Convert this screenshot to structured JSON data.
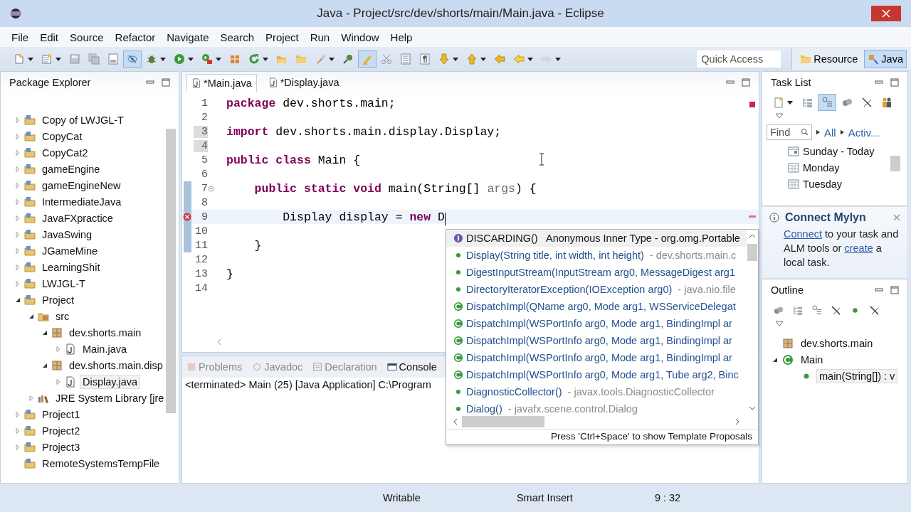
{
  "window": {
    "title": "Java - Project/src/dev/shorts/main/Main.java - Eclipse"
  },
  "menu": [
    "File",
    "Edit",
    "Source",
    "Refactor",
    "Navigate",
    "Search",
    "Project",
    "Run",
    "Window",
    "Help"
  ],
  "toolbar": {
    "buttons": [
      {
        "kind": "new-file",
        "dropdown": true,
        "pressed": false
      },
      {
        "kind": "new-package",
        "dropdown": true,
        "pressed": false
      },
      {
        "kind": "save",
        "dropdown": false,
        "pressed": false
      },
      {
        "kind": "save-all",
        "dropdown": false,
        "pressed": false
      },
      {
        "kind": "binary-page",
        "dropdown": false,
        "pressed": false
      },
      {
        "kind": "eye-crossed",
        "dropdown": false,
        "pressed": true
      },
      {
        "kind": "bug",
        "dropdown": true,
        "pressed": false
      },
      {
        "kind": "play",
        "dropdown": true,
        "pressed": false
      },
      {
        "kind": "play-box",
        "dropdown": true,
        "pressed": false
      },
      {
        "kind": "package-box",
        "dropdown": false,
        "pressed": false
      },
      {
        "kind": "refresh",
        "dropdown": true,
        "pressed": false
      },
      {
        "kind": "folder-open",
        "dropdown": false,
        "pressed": false
      },
      {
        "kind": "folder",
        "dropdown": false,
        "pressed": false
      },
      {
        "kind": "brush",
        "dropdown": true,
        "pressed": false
      },
      {
        "kind": "pin",
        "dropdown": false,
        "pressed": false
      },
      {
        "kind": "highlighter",
        "dropdown": false,
        "pressed": true
      },
      {
        "kind": "scissors",
        "dropdown": false,
        "pressed": false
      },
      {
        "kind": "list-page",
        "dropdown": false,
        "pressed": false
      },
      {
        "kind": "pilcrow-page",
        "dropdown": false,
        "pressed": false
      },
      {
        "kind": "arrow-down",
        "dropdown": true,
        "pressed": false
      },
      {
        "kind": "arrow-up",
        "dropdown": true,
        "pressed": false
      },
      {
        "kind": "arrow-left-edit",
        "dropdown": false,
        "pressed": false
      },
      {
        "kind": "arrow-left",
        "dropdown": true,
        "pressed": false
      },
      {
        "kind": "arrow-right",
        "dropdown": true,
        "pressed": false
      }
    ],
    "quick_access": {
      "placeholder": "Quick Access"
    },
    "perspectives": [
      {
        "label": "Resource",
        "kind": "folder",
        "selected": false
      },
      {
        "label": "Java",
        "kind": "java",
        "selected": true
      }
    ]
  },
  "package_explorer": {
    "title": "Package Explorer",
    "items": [
      {
        "label": "Copy of LWJGL-T",
        "kind": "project",
        "expanded": false,
        "selected": false
      },
      {
        "label": "CopyCat",
        "kind": "project",
        "expanded": false,
        "selected": false
      },
      {
        "label": "CopyCat2",
        "kind": "project",
        "expanded": false,
        "selected": false
      },
      {
        "label": "gameEngine",
        "kind": "project",
        "expanded": false,
        "selected": false
      },
      {
        "label": "gameEngineNew",
        "kind": "project",
        "expanded": false,
        "selected": false
      },
      {
        "label": "IntermediateJava",
        "kind": "project",
        "expanded": false,
        "selected": false
      },
      {
        "label": "JavaFXpractice",
        "kind": "project",
        "expanded": false,
        "selected": false
      },
      {
        "label": "JavaSwing",
        "kind": "project",
        "expanded": false,
        "selected": false
      },
      {
        "label": "JGameMine",
        "kind": "project",
        "expanded": false,
        "selected": false
      },
      {
        "label": "LearningShit",
        "kind": "project",
        "expanded": false,
        "selected": false
      },
      {
        "label": "LWJGL-T",
        "kind": "project",
        "expanded": false,
        "selected": false
      },
      {
        "label": "Project",
        "kind": "project",
        "expanded": true,
        "selected": false,
        "children": [
          {
            "label": "src",
            "kind": "source-folder",
            "expanded": true,
            "selected": false,
            "children": [
              {
                "label": "dev.shorts.main",
                "kind": "package",
                "expanded": true,
                "selected": false,
                "children": [
                  {
                    "label": "Main.java",
                    "kind": "java-file",
                    "expanded": false,
                    "selected": false
                  }
                ]
              },
              {
                "label": "dev.shorts.main.disp",
                "kind": "package",
                "expanded": true,
                "selected": false,
                "children": [
                  {
                    "label": "Display.java",
                    "kind": "java-file",
                    "expanded": false,
                    "selected": true
                  }
                ]
              }
            ]
          },
          {
            "label": "JRE System Library [jre",
            "kind": "library",
            "expanded": false,
            "selected": false
          }
        ]
      },
      {
        "label": "Project1",
        "kind": "project",
        "expanded": false,
        "selected": false
      },
      {
        "label": "Project2",
        "kind": "project",
        "expanded": false,
        "selected": false
      },
      {
        "label": "Project3",
        "kind": "project",
        "expanded": false,
        "selected": false
      },
      {
        "label": "RemoteSystemsTempFile",
        "kind": "project",
        "selected": false
      }
    ]
  },
  "editor": {
    "tabs": [
      {
        "label": "*Main.java",
        "selected": true
      },
      {
        "label": "*Display.java",
        "selected": false
      }
    ],
    "lines": [
      {
        "number": "1",
        "tokens": [
          {
            "kind": "keyword",
            "text": "package"
          },
          {
            "kind": "plain",
            "text": " dev.shorts.main;"
          }
        ],
        "shaded": false,
        "changed": false,
        "error": false
      },
      {
        "number": "2",
        "shaded": false,
        "changed": false,
        "error": false
      },
      {
        "number": "3",
        "tokens": [
          {
            "kind": "keyword",
            "text": "import"
          },
          {
            "kind": "plain",
            "text": " dev.shorts.main.display.Display;"
          }
        ],
        "shaded": true,
        "changed": false,
        "error": false
      },
      {
        "number": "4",
        "shaded": true,
        "changed": false,
        "error": false
      },
      {
        "number": "5",
        "tokens": [
          {
            "kind": "keyword",
            "text": "public class"
          },
          {
            "kind": "plain",
            "text": " Main {"
          }
        ],
        "shaded": false,
        "changed": false,
        "error": false
      },
      {
        "number": "6",
        "shaded": false,
        "changed": false,
        "error": false
      },
      {
        "number": "7",
        "tokens": [
          {
            "kind": "keyword",
            "text": "    public static void"
          },
          {
            "kind": "plain",
            "text": " main(String[] "
          },
          {
            "kind": "param",
            "text": "args"
          },
          {
            "kind": "plain",
            "text": ") {"
          }
        ],
        "shaded": false,
        "changed": true,
        "error": false,
        "foldable": true
      },
      {
        "number": "8",
        "shaded": false,
        "changed": true,
        "error": false
      },
      {
        "number": "9",
        "tokens": [
          {
            "kind": "plain",
            "text": "        Display display = "
          },
          {
            "kind": "keyword",
            "text": "new"
          },
          {
            "kind": "plain",
            "text": " D"
          }
        ],
        "shaded": false,
        "changed": true,
        "error": true,
        "current": true
      },
      {
        "number": "10",
        "shaded": false,
        "changed": true,
        "error": false
      },
      {
        "number": "11",
        "tokens": [
          {
            "kind": "plain",
            "text": "    }"
          }
        ],
        "shaded": false,
        "changed": true,
        "error": false
      },
      {
        "number": "12",
        "shaded": false,
        "changed": false,
        "error": false
      },
      {
        "number": "13",
        "tokens": [
          {
            "kind": "plain",
            "text": "}"
          }
        ],
        "shaded": false,
        "changed": false,
        "error": false
      },
      {
        "number": "14",
        "shaded": false,
        "changed": false,
        "error": false
      }
    ]
  },
  "proposals": {
    "items": [
      {
        "kind": "interface",
        "name": "DISCARDING()",
        "detail": "  Anonymous Inner Type - org.omg.Portable",
        "selected": true
      },
      {
        "kind": "constructor",
        "name": "Display(String title, int width, int height)",
        "detail": " - dev.shorts.main.c",
        "selected": false
      },
      {
        "kind": "constructor",
        "name": "DigestInputStream(InputStream arg0, MessageDigest arg1",
        "selected": false
      },
      {
        "kind": "constructor",
        "name": "DirectoryIteratorException(IOException arg0)",
        "detail": " - java.nio.file",
        "selected": false
      },
      {
        "kind": "class",
        "name": "DispatchImpl(QName arg0, Mode arg1, WSServiceDelegat",
        "selected": false
      },
      {
        "kind": "class",
        "name": "DispatchImpl(WSPortInfo arg0, Mode arg1, BindingImpl ar",
        "selected": false
      },
      {
        "kind": "class",
        "name": "DispatchImpl(WSPortInfo arg0, Mode arg1, BindingImpl ar",
        "selected": false
      },
      {
        "kind": "class",
        "name": "DispatchImpl(WSPortInfo arg0, Mode arg1, BindingImpl ar",
        "selected": false
      },
      {
        "kind": "class",
        "name": "DispatchImpl(WSPortInfo arg0, Mode arg1, Tube arg2, Binc",
        "selected": false
      },
      {
        "kind": "constructor",
        "name": "DiagnosticCollector()",
        "detail": " - javax.tools.DiagnosticCollector",
        "selected": false
      },
      {
        "kind": "constructor",
        "name": "Dialog()",
        "detail": " - javafx.scene.control.Dialog",
        "selected": false
      }
    ],
    "hint": "Press 'Ctrl+Space' to show Template Proposals"
  },
  "views": {
    "tabs": [
      {
        "label": "Problems",
        "kind": "problems",
        "selected": false
      },
      {
        "label": "Javadoc",
        "kind": "javadoc",
        "selected": false
      },
      {
        "label": "Declaration",
        "kind": "declaration",
        "selected": false
      },
      {
        "label": "Console",
        "kind": "console",
        "selected": true
      }
    ],
    "console": "<terminated> Main (25) [Java Application] C:\\Program"
  },
  "task_list": {
    "title": "Task List",
    "tools": [
      {
        "kind": "new-task",
        "dropdown": true,
        "pressed": false
      },
      {
        "kind": "tree-list",
        "dropdown": false,
        "pressed": false
      },
      {
        "kind": "categorized",
        "dropdown": false,
        "pressed": true
      },
      {
        "kind": "spheres",
        "dropdown": false,
        "pressed": false
      },
      {
        "kind": "slash",
        "dropdown": false,
        "pressed": false
      },
      {
        "kind": "people",
        "dropdown": false,
        "pressed": false
      }
    ],
    "find": {
      "placeholder": "Find"
    },
    "filters": [
      "All",
      "Activ..."
    ],
    "items": [
      {
        "label": "Sunday - Today",
        "kind": "today"
      },
      {
        "label": "Monday",
        "kind": "day"
      },
      {
        "label": "Tuesday",
        "kind": "day"
      }
    ]
  },
  "mylyn": {
    "title": "Connect Mylyn",
    "text": [
      {
        "kind": "link",
        "text": "Connect"
      },
      {
        "kind": "plain",
        "text": " to your task and ALM tools or "
      },
      {
        "kind": "link",
        "text": "create"
      },
      {
        "kind": "plain",
        "text": " a local task."
      }
    ]
  },
  "outline": {
    "title": "Outline",
    "items": [
      {
        "label": "dev.shorts.main",
        "kind": "package",
        "selected": false
      },
      {
        "label": "Main",
        "kind": "class",
        "expanded": true,
        "selected": false,
        "children": [
          {
            "label": "main(String[]) : v",
            "kind": "method",
            "selected": true
          }
        ]
      }
    ]
  },
  "status_bar": [
    "Writable",
    "Smart Insert",
    "9 : 32"
  ]
}
